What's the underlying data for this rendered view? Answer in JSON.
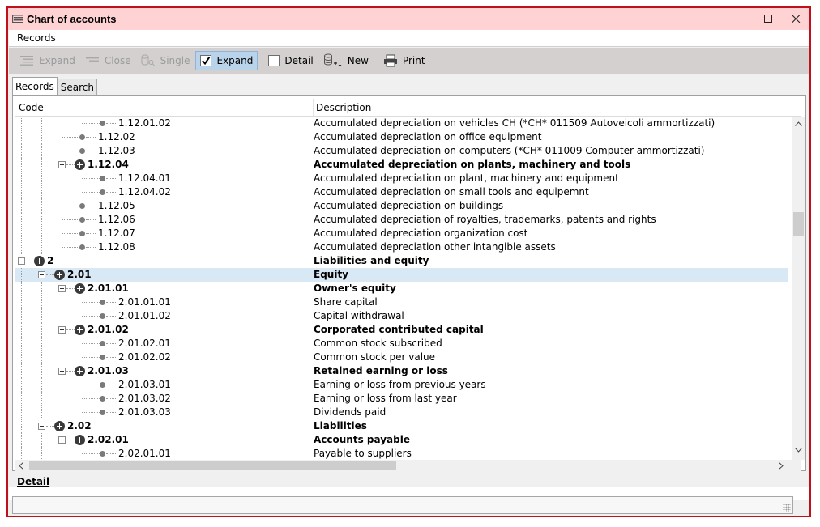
{
  "window": {
    "title": "Chart of accounts"
  },
  "menu": {
    "items": [
      "Records"
    ]
  },
  "toolbar": {
    "expand_disabled": "Expand",
    "close": "Close",
    "single": "Single",
    "expand": "Expand",
    "detail": "Detail",
    "new": "New",
    "print": "Print"
  },
  "tabs": {
    "records": "Records",
    "search": "Search"
  },
  "grid": {
    "columns": {
      "code": "Code",
      "description": "Description"
    },
    "rows": [
      {
        "code": "1.12.01.02",
        "desc": "Accumulated depreciation on vehicles CH (*CH* 011509 Autoveicoli ammortizzati)"
      },
      {
        "code": "1.12.02",
        "desc": "Accumulated depreciation on office equipment"
      },
      {
        "code": "1.12.03",
        "desc": "Accumulated depreciation on computers (*CH* 011009 Computer ammortizzati)"
      },
      {
        "code": "1.12.04",
        "desc": "Accumulated depreciation on plants, machinery and tools"
      },
      {
        "code": "1.12.04.01",
        "desc": "Accumulated depreciation on plant, machinery and equipment"
      },
      {
        "code": "1.12.04.02",
        "desc": "Accumulated depreciation on small tools and equipemnt"
      },
      {
        "code": "1.12.05",
        "desc": "Accumulated depreciation on buildings"
      },
      {
        "code": "1.12.06",
        "desc": "Accumulated depreciation of royalties, trademarks, patents and rights"
      },
      {
        "code": "1.12.07",
        "desc": "Accumulated depreciation organization cost"
      },
      {
        "code": "1.12.08",
        "desc": "Accumulated depreciation other intangible assets"
      },
      {
        "code": "2",
        "desc": "Liabilities and equity"
      },
      {
        "code": "2.01",
        "desc": "Equity"
      },
      {
        "code": "2.01.01",
        "desc": "Owner's equity"
      },
      {
        "code": "2.01.01.01",
        "desc": "Share capital"
      },
      {
        "code": "2.01.01.02",
        "desc": "Capital withdrawal"
      },
      {
        "code": "2.01.02",
        "desc": "Corporated contributed capital"
      },
      {
        "code": "2.01.02.01",
        "desc": "Common stock subscribed"
      },
      {
        "code": "2.01.02.02",
        "desc": "Common stock per value"
      },
      {
        "code": "2.01.03",
        "desc": "Retained earning or loss"
      },
      {
        "code": "2.01.03.01",
        "desc": "Earning or loss from previous years"
      },
      {
        "code": "2.01.03.02",
        "desc": "Earning or loss from last year"
      },
      {
        "code": "2.01.03.03",
        "desc": "Dividends paid"
      },
      {
        "code": "2.02",
        "desc": "Liabilities"
      },
      {
        "code": "2.02.01",
        "desc": "Accounts payable"
      },
      {
        "code": "2.02.01.01",
        "desc": "Payable to suppliers"
      }
    ]
  },
  "detail": {
    "label": "Detail"
  }
}
